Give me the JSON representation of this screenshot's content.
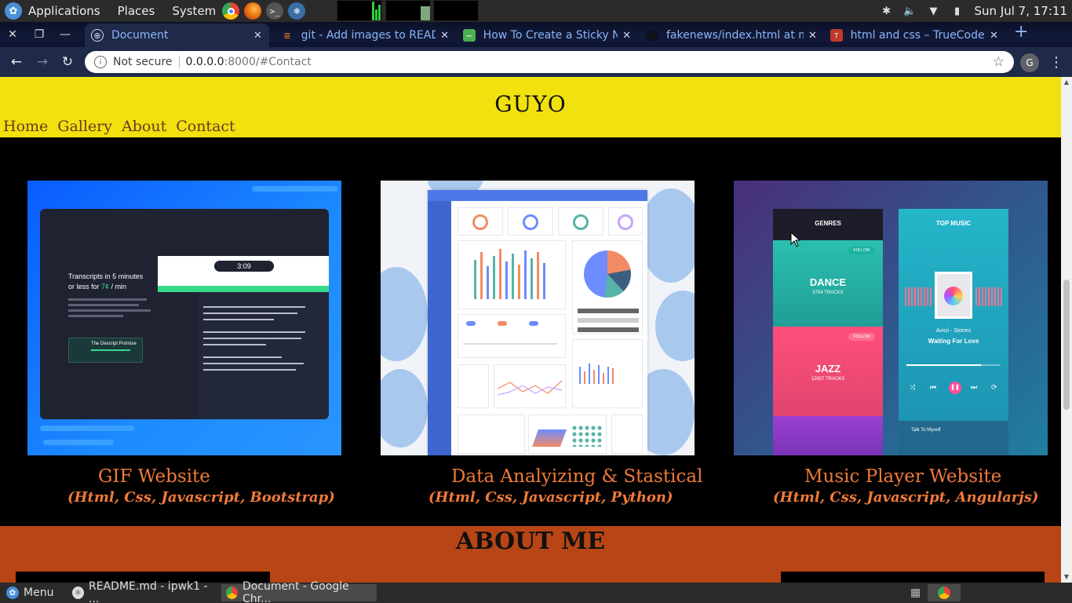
{
  "system_panel": {
    "menus": [
      "Applications",
      "Places",
      "System"
    ],
    "clock": "Sun Jul 7, 17:11"
  },
  "browser": {
    "tabs": [
      {
        "title": "Document",
        "active": true
      },
      {
        "title": "git - Add images to READ",
        "active": false
      },
      {
        "title": "How To Create a Sticky N",
        "active": false
      },
      {
        "title": "fakenews/index.html at m",
        "active": false
      },
      {
        "title": "html and css – TrueCode",
        "active": false
      }
    ],
    "address": {
      "security": "Not secure",
      "url_host": "0.0.0.0",
      "url_rest": ":8000/#Contact"
    },
    "profile_initial": "G"
  },
  "site": {
    "title": "GUYO",
    "nav": [
      "Home",
      "Gallery",
      "About",
      "Contact"
    ],
    "projects": [
      {
        "title": "GIF Website",
        "tech": "(Html, Css, Javascript, Bootstrap)"
      },
      {
        "title": "Data Analyizing & Stastical",
        "tech": "(Html, Css, Javascript, Python)"
      },
      {
        "title": "Music Player Website",
        "tech": "(Html, Css, Javascript, Angularjs)"
      }
    ],
    "thumb1": {
      "headline_a": "Transcripts in 5 minutes",
      "headline_b": "or less for",
      "price": "7¢",
      "per": "/ min",
      "timer": "3:09",
      "promise": "The Descript Promise"
    },
    "thumb3": {
      "genres": "GENRES",
      "top_music": "TOP MUSIC",
      "g1": "DANCE",
      "g1_sub": "3754 TRACKS",
      "g2": "JAZZ",
      "g2_sub": "12857 TRACKS",
      "follow": "FOLLOW",
      "artist": "Avicii - Stories",
      "song": "Waiting For Love",
      "next_song": "Talk To Myself"
    },
    "about_title": "ABOUT ME"
  },
  "taskbar": {
    "menu": "Menu",
    "items": [
      {
        "title": "README.md - ipwk1 - ...",
        "active": false
      },
      {
        "title": "Document - Google Chr...",
        "active": true
      }
    ]
  }
}
